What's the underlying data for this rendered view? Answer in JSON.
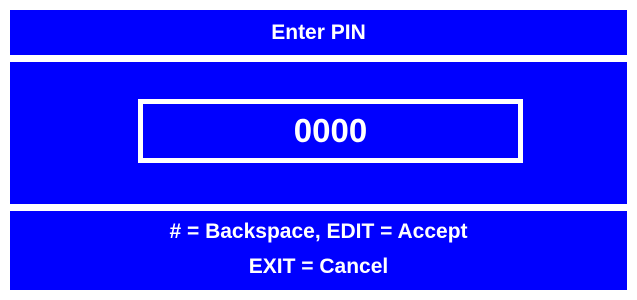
{
  "screen": {
    "title": "Enter PIN",
    "pin_value": "0000",
    "instructions": [
      "# = Backspace, EDIT = Accept",
      "EXIT = Cancel"
    ]
  },
  "colors": {
    "panel_background": "#0000ff",
    "text": "#ffffff",
    "page_background": "#ffffff"
  }
}
